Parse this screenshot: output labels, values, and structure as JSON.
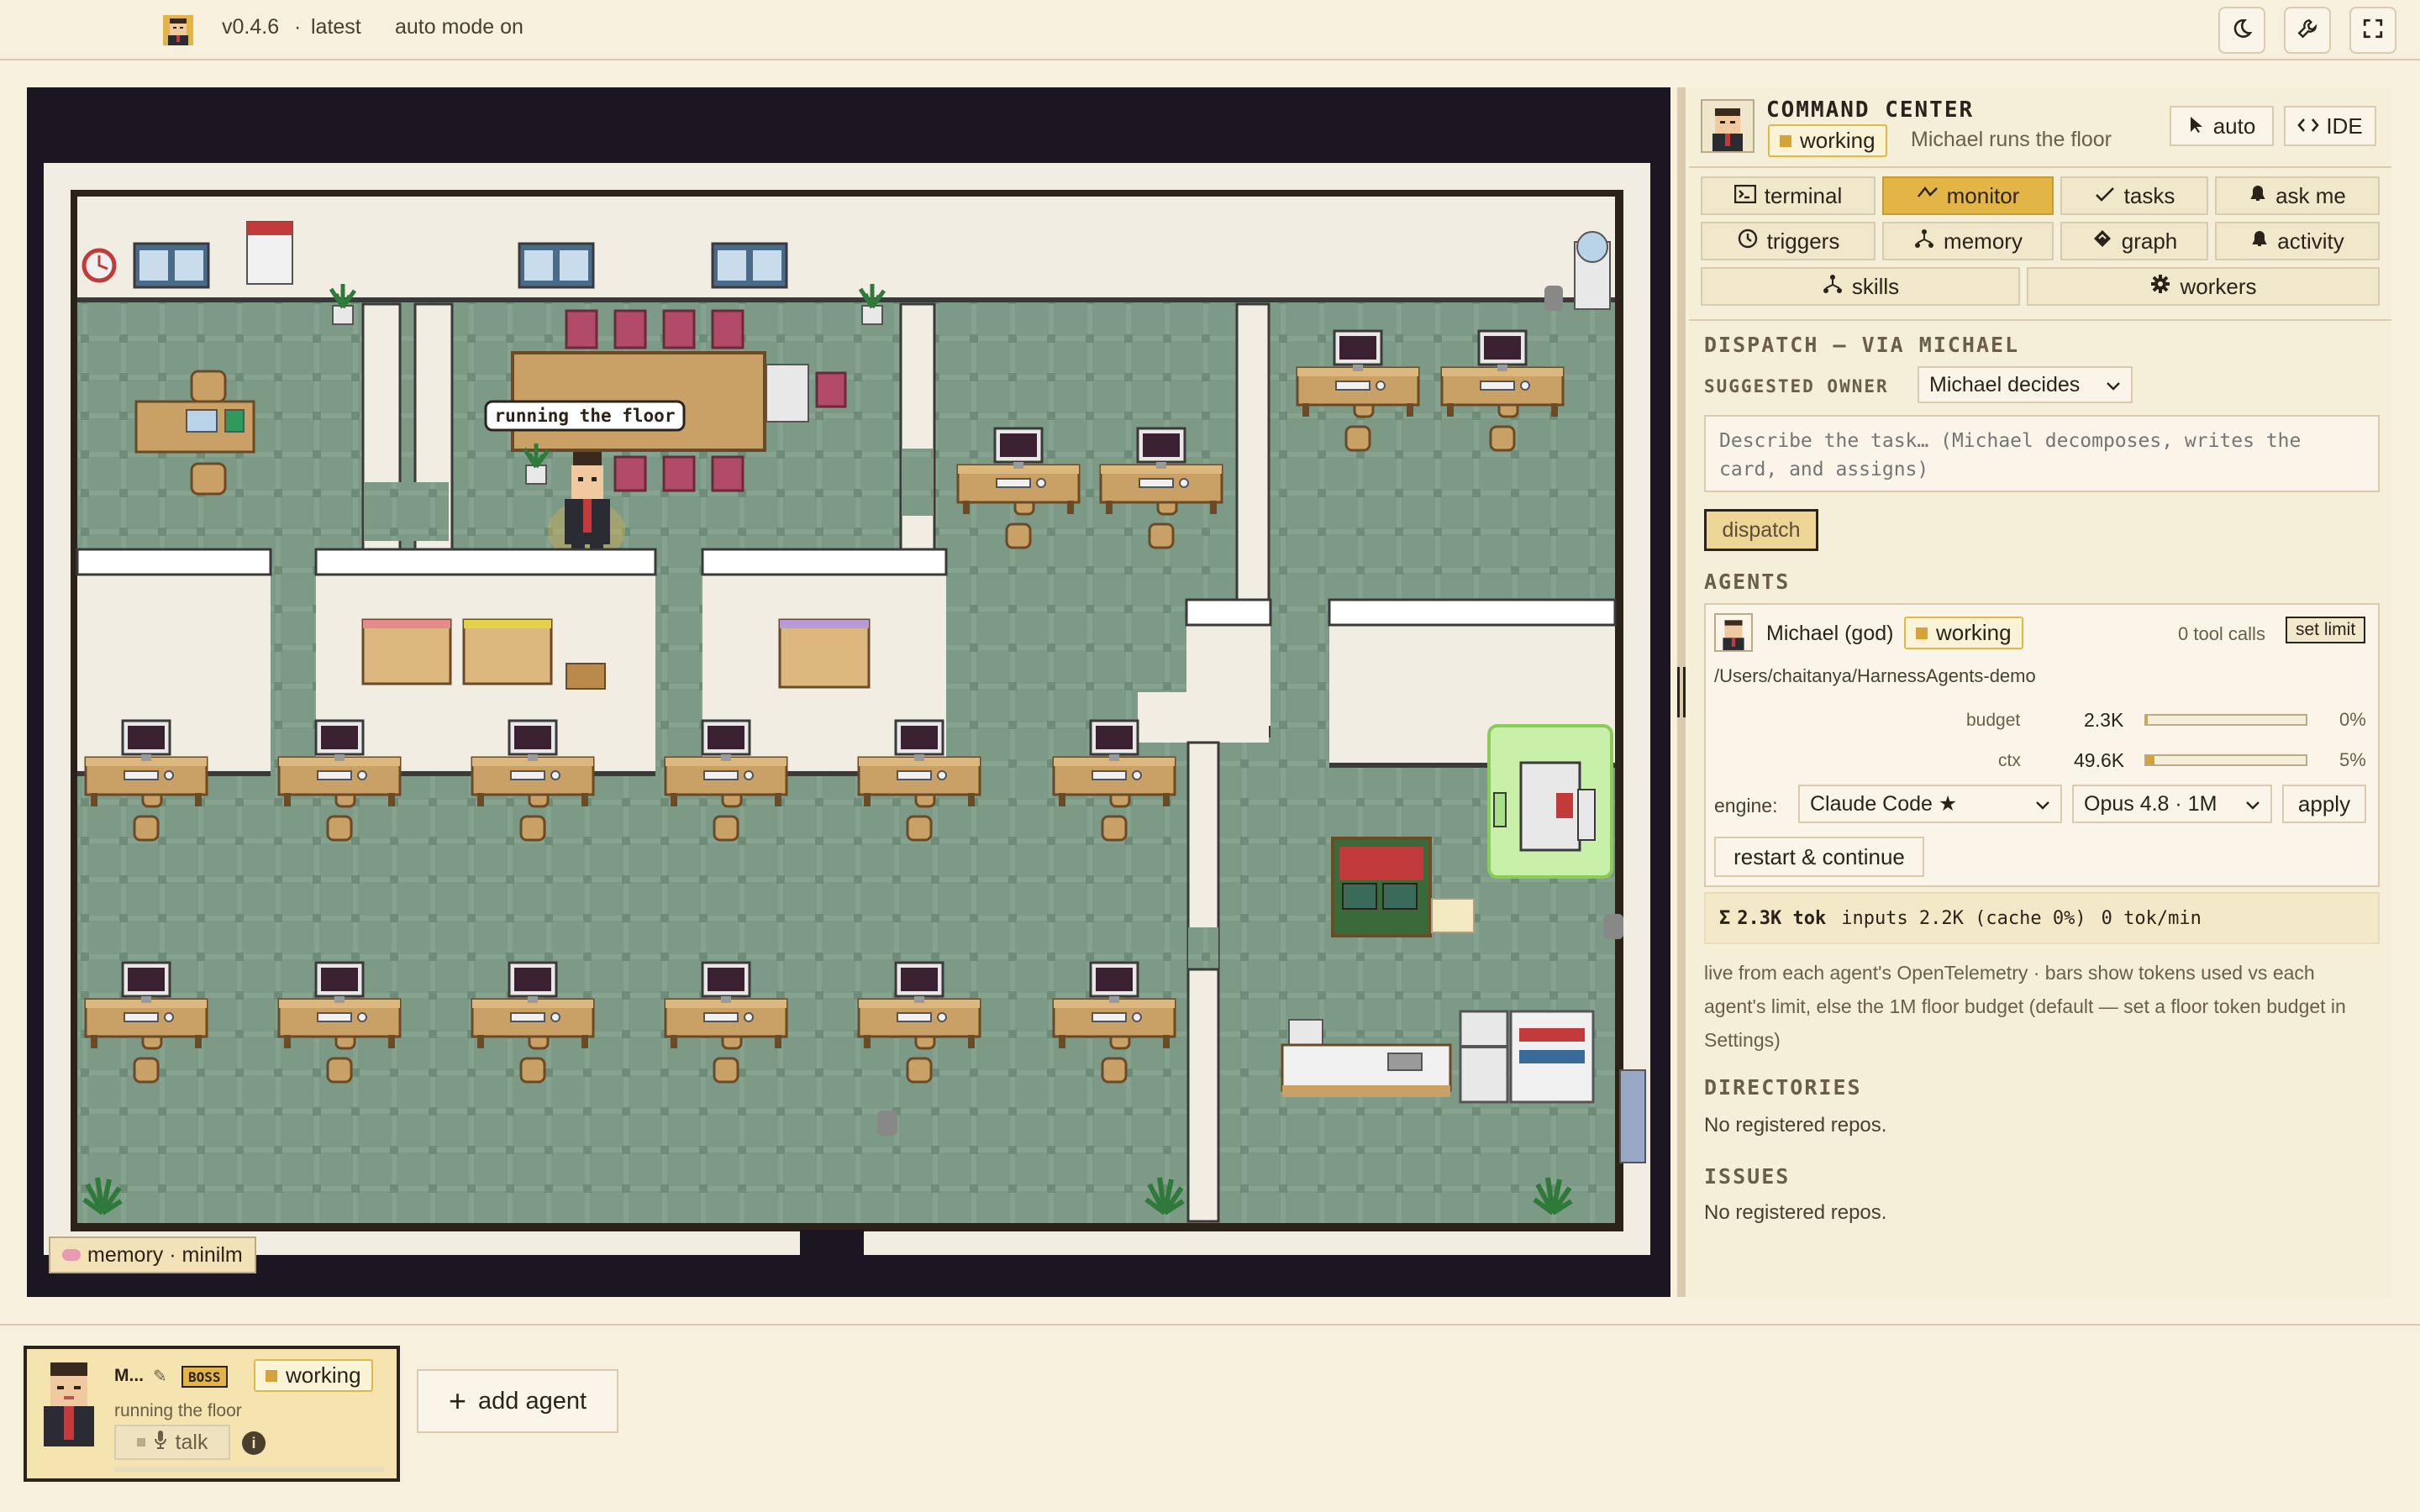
{
  "topbar": {
    "version": "v0.4.6",
    "separator": "·",
    "channel": "latest",
    "mode": "auto mode on",
    "icons": [
      "moon-icon",
      "wrench-icon",
      "fullscreen-icon"
    ]
  },
  "game": {
    "speech_bubble": "running the floor",
    "memory_badge": "memory · minilm"
  },
  "command_center": {
    "title": "COMMAND CENTER",
    "status": "working",
    "subtitle": "Michael runs the floor",
    "auto_button": "auto",
    "ide_button": "IDE",
    "tabs": {
      "terminal": "terminal",
      "monitor": "monitor",
      "tasks": "tasks",
      "ask_me": "ask me",
      "triggers": "triggers",
      "memory": "memory",
      "graph": "graph",
      "activity": "activity",
      "skills": "skills",
      "workers": "workers"
    }
  },
  "dispatch": {
    "heading": "DISPATCH — VIA MICHAEL",
    "owner_label": "SUGGESTED OWNER",
    "owner_value": "Michael decides",
    "placeholder": "Describe the task… (Michael decomposes, writes the card, and assigns)",
    "button": "dispatch"
  },
  "agents": {
    "heading": "AGENTS",
    "card": {
      "name": "Michael (god)",
      "status": "working",
      "tool_calls": "0 tool calls",
      "set_limit": "set limit",
      "path": "/Users/chaitanya/HarnessAgents-demo",
      "budget_label": "budget",
      "budget_value": "2.3K",
      "budget_pct": "0%",
      "budget_fraction": 0.0,
      "ctx_label": "ctx",
      "ctx_value": "49.6K",
      "ctx_pct": "5%",
      "ctx_fraction": 0.05,
      "engine_label": "engine:",
      "engine_value": "Claude Code ★",
      "model_value": "Opus 4.8 · 1M",
      "apply": "apply",
      "restart": "restart & continue"
    },
    "totals": {
      "sigma": "Σ",
      "tokens": "2.3K tok",
      "inputs": "inputs 2.2K (cache 0%)",
      "rate": "0 tok/min"
    },
    "note": "live from each agent's OpenTelemetry · bars show tokens used vs each agent's limit, else the 1M floor budget (default — set a floor token budget in Settings)"
  },
  "directories": {
    "heading": "DIRECTORIES",
    "empty": "No registered repos."
  },
  "issues": {
    "heading": "ISSUES",
    "empty": "No registered repos."
  },
  "bottom": {
    "agent_card": {
      "name": "M...",
      "role": "BOSS",
      "status": "working",
      "activity": "running the floor",
      "talk": "talk"
    },
    "add_agent": "add agent",
    "add_symbol": "+"
  },
  "colors": {
    "accent": "#e3b546",
    "floor": "#7d9a86",
    "wall": "#f1ede3",
    "desk": "#c9a167",
    "background": "#f7f0dc"
  }
}
